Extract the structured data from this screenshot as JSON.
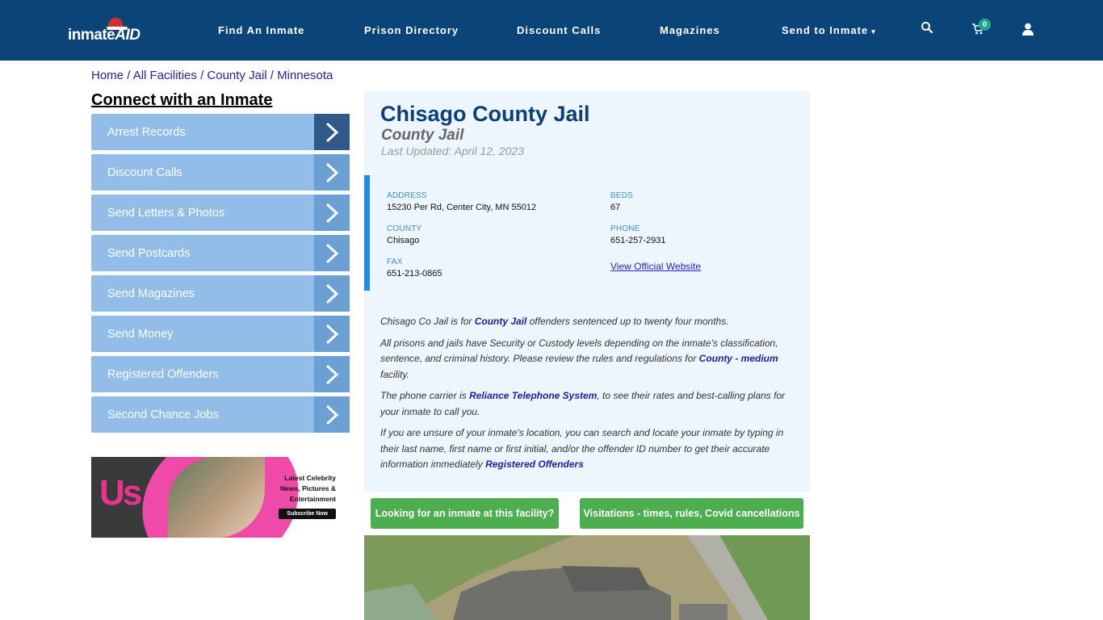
{
  "header": {
    "logo_text_a": "inmate",
    "logo_text_b": "AID",
    "nav": [
      {
        "label": "Find An Inmate"
      },
      {
        "label": "Prison Directory"
      },
      {
        "label": "Discount Calls"
      },
      {
        "label": "Magazines"
      },
      {
        "label": "Send to Inmate",
        "has_dropdown": true
      }
    ],
    "caret": "▾",
    "cart_count": "0",
    "icons": [
      "search-icon",
      "cart-icon",
      "user-icon"
    ]
  },
  "breadcrumb": [
    {
      "label": "Home"
    },
    {
      "label": "All Facilities"
    },
    {
      "label": "County Jail"
    },
    {
      "label": "Minnesota"
    }
  ],
  "breadcrumb_sep": "/",
  "sidebar": {
    "title": "Connect with an Inmate",
    "items": [
      {
        "label": "Arrest Records"
      },
      {
        "label": "Discount Calls"
      },
      {
        "label": "Send Letters & Photos"
      },
      {
        "label": "Send Postcards"
      },
      {
        "label": "Send Magazines"
      },
      {
        "label": "Send Money"
      },
      {
        "label": "Registered Offenders"
      },
      {
        "label": "Second Chance Jobs"
      }
    ],
    "ad": {
      "brand": "Us",
      "tagline_1": "Latest Celebrity",
      "tagline_2": "News, Pictures &",
      "tagline_3": "Entertainment",
      "cta": "Subscribe Now"
    }
  },
  "facility": {
    "name": "Chisago County Jail",
    "type": "County Jail",
    "last_updated": "Last Updated: April 12, 2023",
    "fields": {
      "address_label": "ADDRESS",
      "address": "15230 Per Rd, Center City, MN 55012",
      "beds_label": "BEDS",
      "beds": "67",
      "county_label": "COUNTY",
      "county": "Chisago",
      "phone_label": "PHONE",
      "phone": "651-257-2931",
      "fax_label": "FAX",
      "fax": "651-213-0865",
      "website_link": "View Official Website"
    },
    "description": {
      "p1_a": "Chisago Co Jail is for ",
      "p1_link": "County Jail",
      "p1_b": " offenders sentenced up to twenty four months.",
      "p2_a": "All prisons and jails have Security or Custody levels depending on the inmate's classification, sentence, and criminal history. Please review the rules and regulations for ",
      "p2_link": "County - medium",
      "p2_b": " facility.",
      "p3_a": "The phone carrier is ",
      "p3_link": "Reliance Telephone System",
      "p3_b": ", to see their rates and best-calling plans for your inmate to call you.",
      "p4_a": "If you are unsure of your inmate's location, you can search and locate your inmate by typing in their last name, first name or first initial, and/or the offender ID number to get their accurate information immediately ",
      "p4_link": "Registered Offenders"
    },
    "buttons": {
      "find_inmate": "Looking for an inmate at this facility?",
      "visitation": "Visitations - times, rules, Covid cancellations"
    }
  },
  "colors": {
    "header_bg": "#0b4478",
    "sidebar_item": "#92bde8",
    "sidebar_arrow": "#6c9fd4",
    "panel_bg": "#edf6fd",
    "accent_blue": "#1a8ef0",
    "green_button": "#4cae4f"
  }
}
